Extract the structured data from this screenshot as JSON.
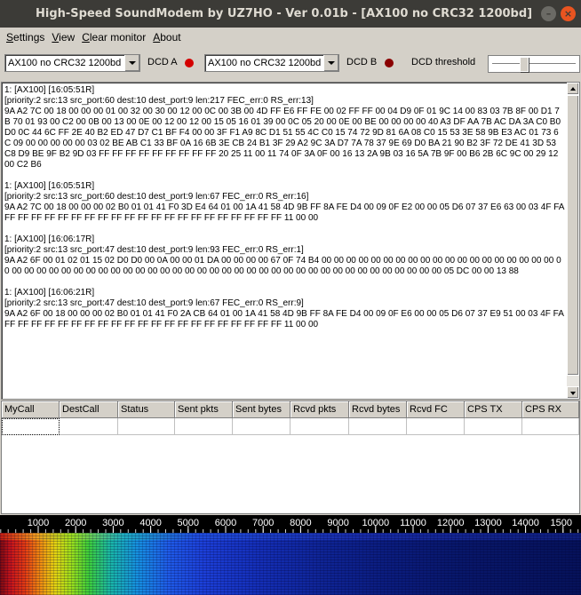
{
  "window": {
    "title": "High-Speed SoundModem by UZ7HO - Ver 0.01b - [AX100 no CRC32 1200bd]",
    "minimize_glyph": "–",
    "close_glyph": "×"
  },
  "menu": {
    "items": [
      {
        "u": "S",
        "rest": "ettings"
      },
      {
        "u": "V",
        "rest": "iew"
      },
      {
        "u": "C",
        "rest": "lear monitor"
      },
      {
        "u": "A",
        "rest": "bout"
      }
    ]
  },
  "toolbar": {
    "mode_a": "AX100 no CRC32 1200bd",
    "dcd_a_label": "DCD A",
    "mode_b": "AX100 no CRC32 1200bd",
    "dcd_b_label": "DCD B",
    "dcd_threshold_label": "DCD threshold",
    "dcd_a_color": "#d40000",
    "dcd_b_color": "#8a0000",
    "dcd_threshold_fraction": 0.38
  },
  "monitor": {
    "text": "1: [AX100] [16:05:51R]\n[priority:2 src:13 src_port:60 dest:10 dest_port:9 len:217 FEC_err:0 RS_err:13]\n9A A2 7C 00 18 00 00 00 01 00 32 00 30 00 12 00 0C 00 3B 00 4D FF E6 FF FE 00 02 FF FF 00 04 D9 0F 01 9C 14 00 83 03 7B 8F 00 D1 7B 70 01 93 00 C2 00 0B 00 13 00 0E 00 12 00 12 00 15 05 16 01 39 00 0C 05 20 00 0E 00 BE 00 00 00 00 40 A3 DF AA 7B AC DA 3A C0 B0 D0 0C 44 6C FF 2E 40 B2 ED 47 D7 C1 BF F4 00 00 3F F1 A9 8C D1 51 55 4C C0 15 74 72 9D 81 6A 08 C0 15 53 3E 58 9B E3 AC 01 73 6C 09 00 00 00 00 00 03 02 BE AB C1 33 BF 0A 16 6B 3E CB 24 B1 3F 29 A2 9C 3A D7 7A 78 37 9E 69 D0 BA 21 90 B2 3F 72 DE 41 3D 53 C8 D9 BE 9F B2 9D 03 FF FF FF FF FF FF FF FF FF 20 25 11 00 11 74 0F 3A 0F 00 16 13 2A 9B 03 16 5A 7B 9F 00 B6 2B 6C 9C 00 29 12 00 C2 B6\n\n1: [AX100] [16:05:51R]\n[priority:2 src:13 src_port:60 dest:10 dest_port:9 len:67 FEC_err:0 RS_err:16]\n9A A2 7C 00 18 00 00 00 02 B0 01 01 41 F0 3D E4 64 01 00 1A 41 58 4D 9B FF 8A FE D4 00 09 0F E2 00 00 05 D6 07 37 E6 63 00 03 4F FA FF FF FF FF FF FF FF FF FF FF FF FF FF FF FF FF FF FF FF FF FF 11 00 00\n\n1: [AX100] [16:06:17R]\n[priority:2 src:13 src_port:47 dest:10 dest_port:9 len:93 FEC_err:0 RS_err:1]\n9A A2 6F 00 01 02 01 15 02 D0 D0 00 0A 00 00 01 DA 00 00 00 00 67 0F 74 B4 00 00 00 00 00 00 00 00 00 00 00 00 00 00 00 00 00 00 00 00 00 00 00 00 00 00 00 00 00 00 00 00 00 00 00 00 00 00 00 00 00 00 00 00 00 00 00 00 00 00 00 00 00 00 00 05 DC 00 00 13 88\n\n1: [AX100] [16:06:21R]\n[priority:2 src:13 src_port:47 dest:10 dest_port:9 len:67 FEC_err:0 RS_err:9]\n9A A2 6F 00 18 00 00 00 02 B0 01 01 41 F0 2A CB 64 01 00 1A 41 58 4D 9B FF 8A FE D4 00 09 0F E6 00 00 05 D6 07 37 E9 51 00 03 4F FA FF FF FF FF FF FF FF FF FF FF FF FF FF FF FF FF FF FF FF FF FF 11 00 00"
  },
  "table": {
    "columns": [
      "MyCall",
      "DestCall",
      "Status",
      "Sent pkts",
      "Sent bytes",
      "Rcvd pkts",
      "Rcvd bytes",
      "Rcvd FC",
      "CPS TX",
      "CPS RX"
    ]
  },
  "waterfall": {
    "ticks": [
      "1000",
      "2000",
      "3000",
      "4000",
      "5000",
      "6000",
      "7000",
      "8000",
      "9000",
      "10000",
      "11000",
      "12000",
      "13000",
      "14000",
      "1500"
    ]
  }
}
